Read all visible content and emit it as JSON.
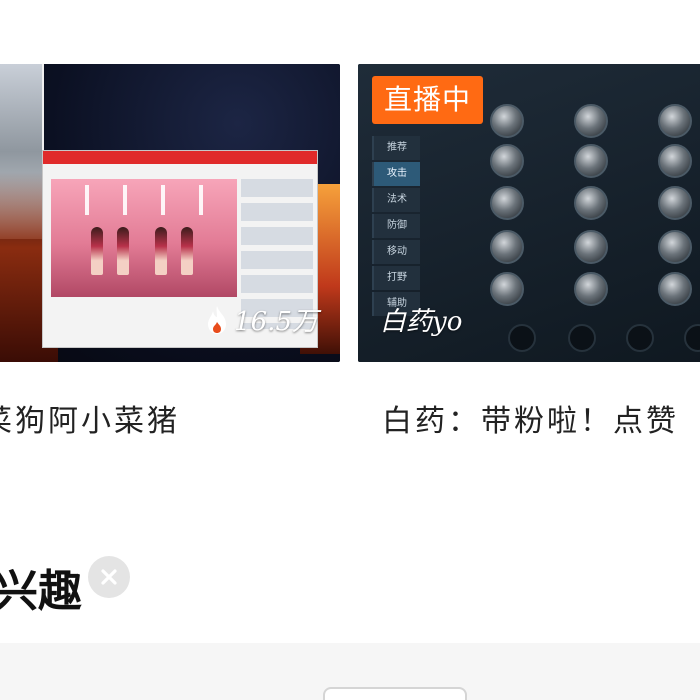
{
  "cards": [
    {
      "id": "left",
      "caption": "菜狗阿小菜猪",
      "stat_text": "16.5万",
      "stat_icon": "flame-icon",
      "link_url": null
    },
    {
      "id": "right",
      "caption": "白药：带粉啦！点赞",
      "badge": "直播中",
      "anchor": "白药yo",
      "menu": [
        "推荐",
        "攻击",
        "法术",
        "防御",
        "移动",
        "打野",
        "辅助"
      ],
      "menu_active_index": 1
    }
  ],
  "section": {
    "title": "兴趣",
    "clear_icon": "close-icon"
  },
  "colors": {
    "live_badge": "#ff6a13",
    "accent_clear": "#e4e4e4"
  }
}
